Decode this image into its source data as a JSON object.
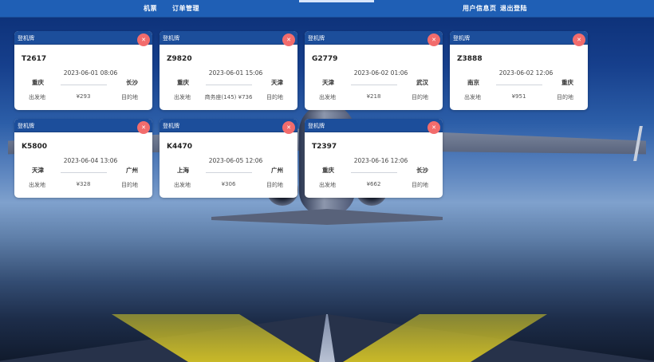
{
  "nav": {
    "items": [
      {
        "label": "机票"
      },
      {
        "label": "订单管理"
      },
      {
        "label": "用户信息页"
      },
      {
        "label": "退出登陆"
      }
    ]
  },
  "card_common": {
    "title": "登机牌",
    "delete_label": "✕",
    "from_label": "出发地",
    "to_label": "目的地"
  },
  "tickets": [
    {
      "flight": "T2617",
      "time": "2023-06-01 08:06",
      "from": "重庆",
      "to": "长沙",
      "price": "¥293"
    },
    {
      "flight": "Z9820",
      "time": "2023-06-01 15:06",
      "from": "重庆",
      "to": "天津",
      "price": "商务座(145) ¥736"
    },
    {
      "flight": "G2779",
      "time": "2023-06-02 01:06",
      "from": "天津",
      "to": "武汉",
      "price": "¥218"
    },
    {
      "flight": "Z3888",
      "time": "2023-06-02 12:06",
      "from": "南京",
      "to": "重庆",
      "price": "¥951"
    },
    {
      "flight": "K5800",
      "time": "2023-06-04 13:06",
      "from": "天津",
      "to": "广州",
      "price": "¥328"
    },
    {
      "flight": "K4470",
      "time": "2023-06-05 12:06",
      "from": "上海",
      "to": "广州",
      "price": "¥306"
    },
    {
      "flight": "T2397",
      "time": "2023-06-16 12:06",
      "from": "重庆",
      "to": "长沙",
      "price": "¥662"
    }
  ],
  "colors": {
    "nav_bg": "#1f5fb5",
    "card_header": "#1c4e9b",
    "delete_button": "#f26c6c"
  }
}
